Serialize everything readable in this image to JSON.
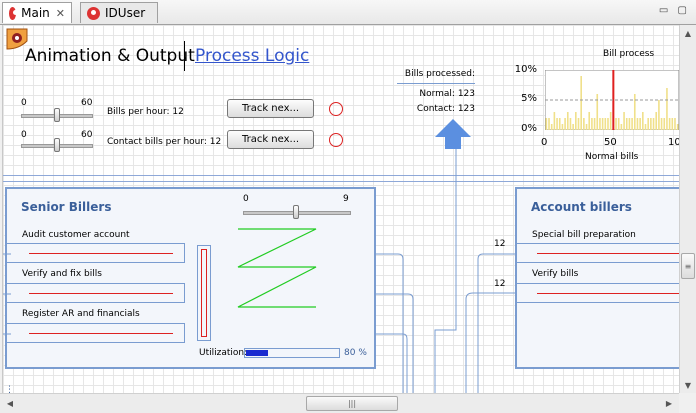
{
  "tabs": [
    {
      "label": "Main",
      "active": true
    },
    {
      "label": "IDUser",
      "active": false
    }
  ],
  "nav": {
    "animation_output": "Animation & Output",
    "process_logic": "Process Logic"
  },
  "controls": {
    "bills_slider": {
      "min": "0",
      "max": "60",
      "label": "Bills per hour: 12"
    },
    "contact_slider": {
      "min": "0",
      "max": "60",
      "label": "Contact bills per hour: 12"
    },
    "track_button_1": "Track nex...",
    "track_button_2": "Track nex..."
  },
  "bills_processed": {
    "title": "Bills processed:",
    "normal": "Normal: 123",
    "contact": "Contact: 123"
  },
  "chart_data": {
    "type": "bar",
    "title": "Bill process",
    "xlabel": "Normal bills",
    "ylabel": "",
    "ylim": [
      0,
      10
    ],
    "xlim": [
      0,
      100
    ],
    "yticks": [
      "10%",
      "5%",
      "0%"
    ],
    "xticks": [
      "0",
      "50",
      "10"
    ],
    "x": [
      1,
      3,
      5,
      7,
      9,
      11,
      13,
      15,
      17,
      19,
      21,
      23,
      25,
      27,
      29,
      31,
      33,
      35,
      37,
      39,
      41,
      43,
      45,
      47,
      49,
      51,
      53,
      55,
      57,
      59,
      61,
      63,
      65,
      67,
      69,
      71,
      73,
      75,
      77,
      79,
      81,
      83,
      85,
      87,
      89,
      91,
      93,
      95,
      97,
      99
    ],
    "values": [
      2,
      2,
      1,
      3,
      2,
      2,
      1,
      2,
      3,
      2,
      1,
      3,
      2,
      9,
      2,
      1,
      3,
      2,
      2,
      6,
      2,
      2,
      2,
      2,
      3,
      10,
      2,
      2,
      1,
      3,
      2,
      2,
      2,
      6,
      2,
      2,
      3,
      1,
      2,
      2,
      2,
      3,
      5,
      2,
      2,
      7,
      2,
      2,
      2,
      1
    ],
    "highlight_x": 51,
    "reference_y": 5,
    "colors": {
      "bar": "#f0e08a",
      "highlight": "#e02020",
      "reference": "#999999"
    }
  },
  "senior": {
    "title": "Senior Billers",
    "slider_min": "0",
    "slider_max": "9",
    "tasks": [
      "Audit customer account",
      "Verify and fix bills",
      "Register AR and financials"
    ],
    "utilization_label": "Utilization:",
    "utilization_value": "80 %",
    "utilization": 0.8
  },
  "account": {
    "title": "Account billers",
    "tasks": [
      "Special bill preparation",
      "Verify bills"
    ],
    "counts": [
      "12",
      "12"
    ]
  },
  "colors": {
    "panel_border": "#7a9cd0",
    "link": "#3355cc",
    "accent_red": "#d22",
    "arrow_blue": "#5b8fe0"
  }
}
